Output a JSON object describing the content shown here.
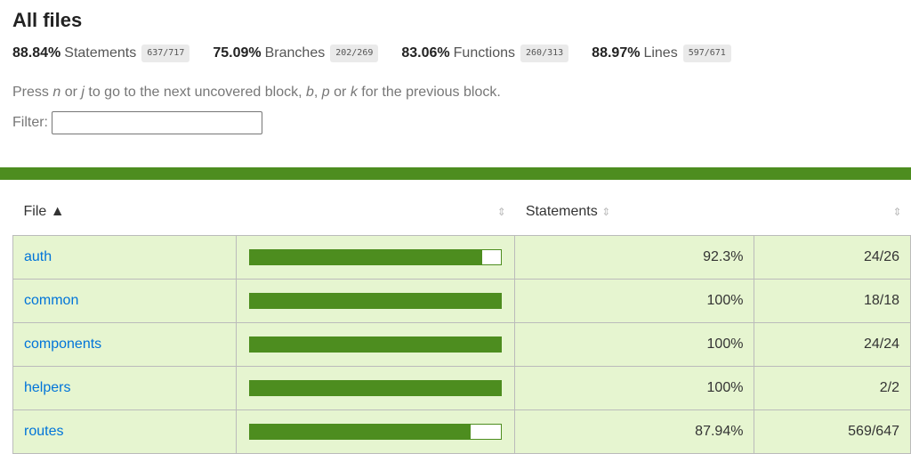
{
  "page": {
    "title": "All files"
  },
  "summary": [
    {
      "pct": "88.84%",
      "label": "Statements",
      "fraction": "637/717"
    },
    {
      "pct": "75.09%",
      "label": "Branches",
      "fraction": "202/269"
    },
    {
      "pct": "83.06%",
      "label": "Functions",
      "fraction": "260/313"
    },
    {
      "pct": "88.97%",
      "label": "Lines",
      "fraction": "597/671"
    }
  ],
  "hint": {
    "t1": "Press ",
    "k1": "n",
    "t2": " or ",
    "k2": "j",
    "t3": " to go to the next uncovered block, ",
    "k3": "b",
    "t4": ", ",
    "k4": "p",
    "t5": " or ",
    "k5": "k",
    "t6": " for the previous block."
  },
  "filter": {
    "label": "Filter:",
    "value": ""
  },
  "table": {
    "headers": {
      "file": "File ▲",
      "statements": "Statements"
    },
    "rows": [
      {
        "file": "auth",
        "coverage": 0.923,
        "pct": "92.3%",
        "abs": "24/26"
      },
      {
        "file": "common",
        "coverage": 1.0,
        "pct": "100%",
        "abs": "18/18"
      },
      {
        "file": "components",
        "coverage": 1.0,
        "pct": "100%",
        "abs": "24/24"
      },
      {
        "file": "helpers",
        "coverage": 1.0,
        "pct": "100%",
        "abs": "2/2"
      },
      {
        "file": "routes",
        "coverage": 0.8794,
        "pct": "87.94%",
        "abs": "569/647"
      }
    ]
  },
  "colors": {
    "covered_high": "#4d8d1f",
    "row_bg": "#e6f5d0",
    "link": "#0074d9"
  }
}
